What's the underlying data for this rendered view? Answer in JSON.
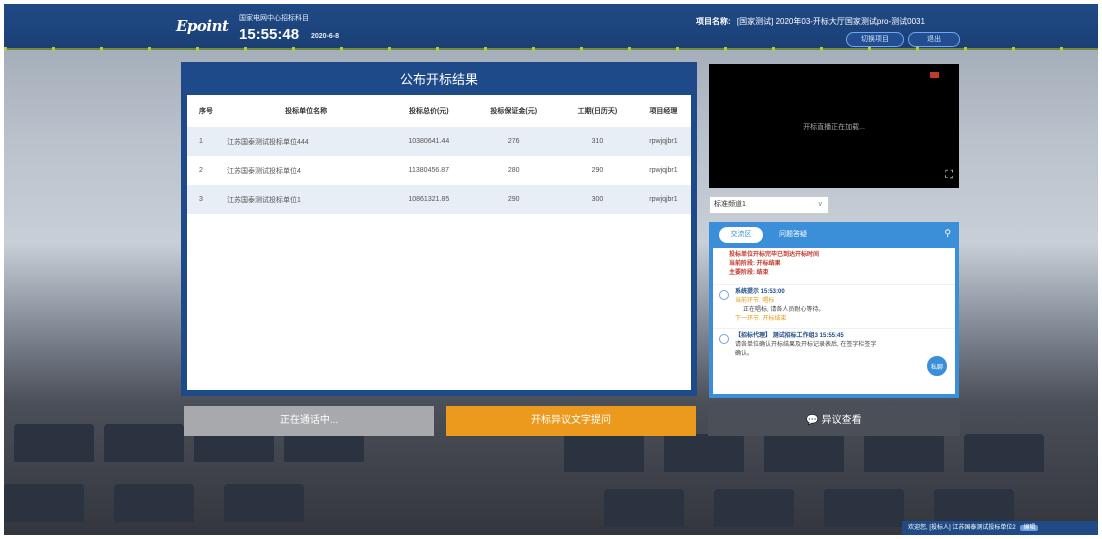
{
  "header": {
    "logo": "Epoint",
    "center_name": "国家电网中心招标科目",
    "time": "15:55:48",
    "date": "2020-6-8",
    "project_label": "项目名称:",
    "project_value": "[国家测试] 2020年03-开标大厅国家测试pro-测试0031",
    "btn_switch": "切换项目",
    "btn_exit": "退出"
  },
  "result": {
    "title": "公布开标结果",
    "columns": [
      "序号",
      "投标单位名称",
      "投标总价(元)",
      "投标保证金(元)",
      "工期(日历天)",
      "项目经理"
    ],
    "rows": [
      [
        "1",
        "江苏国泰测试投标单位444",
        "10380641.44",
        "276",
        "310",
        "rpwjqjbr1"
      ],
      [
        "2",
        "江苏国泰测试投标单位4",
        "11380456.87",
        "280",
        "290",
        "rpwjqjbr1"
      ],
      [
        "3",
        "江苏国泰测试投标单位1",
        "10861321.85",
        "290",
        "300",
        "rpwjqjbr1"
      ]
    ]
  },
  "video": {
    "loading_text": "开标直播正在加载..."
  },
  "channel_select": {
    "value": "标准频道1",
    "arrow": "v"
  },
  "chat": {
    "tab_active": "交流区",
    "tab_other": "问题答疑",
    "red_lines": [
      "投标单位开标完毕已到达开标时间",
      "当前阶段: 开标结果",
      "主要阶段: 结束"
    ],
    "messages": [
      {
        "who": "系统提示 15:53:00",
        "lines_orange": [
          "当前环节: 唱标"
        ],
        "lines_gray": [
          "正在唱标, 请各人员耐心等待。"
        ],
        "lines_orange2": [
          "下一环节: 开标结束"
        ]
      },
      {
        "who": "【招标代理】 测试招标工作组3 15:55:45",
        "lines_text": [
          "请各单位确认开标结果及开标记录表后, 在签字栏签字"
        ],
        "lines_text2": [
          "确认。"
        ]
      }
    ],
    "fab_label": "私聊"
  },
  "buttons": {
    "connecting": "正在通话中...",
    "objection_text": "开标异议文字提问",
    "objection_view": "异议查看"
  },
  "status_bar": {
    "welcome": "欢迎您,",
    "role": "[投标人]",
    "company": "江苏国泰测试投标单位2",
    "tag": "编辑"
  }
}
